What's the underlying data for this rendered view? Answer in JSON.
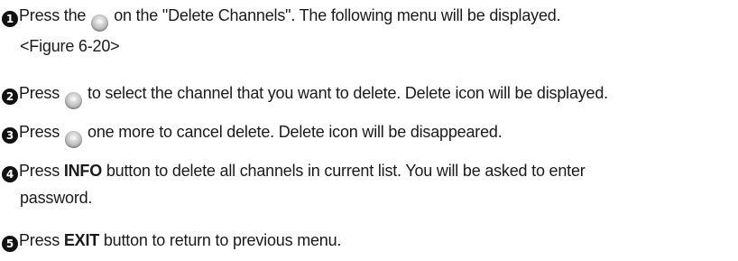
{
  "steps": [
    {
      "number": "1",
      "before": "Press the",
      "button_icon": "ok-button-icon",
      "button_text": "OK",
      "after": "on the \"Delete Channels\". The following menu will be displayed.",
      "continuation": "<Figure 6-20>"
    },
    {
      "number": "2",
      "before": "Press",
      "button_icon": "ok-button-icon",
      "button_text": "OK",
      "after": "to select the channel that you want to delete. Delete icon will be displayed."
    },
    {
      "number": "3",
      "before": "Press",
      "button_icon": "ok-button-icon",
      "button_text": "OK",
      "after": "one more to cancel delete. Delete icon will be disappeared."
    },
    {
      "number": "4",
      "before": "Press",
      "bold": "INFO",
      "after": "button to delete all channels in current list. You will be asked to enter",
      "continuation": "password."
    },
    {
      "number": "5",
      "before": "Press",
      "bold": "EXIT",
      "after": "button to return to previous menu."
    }
  ]
}
